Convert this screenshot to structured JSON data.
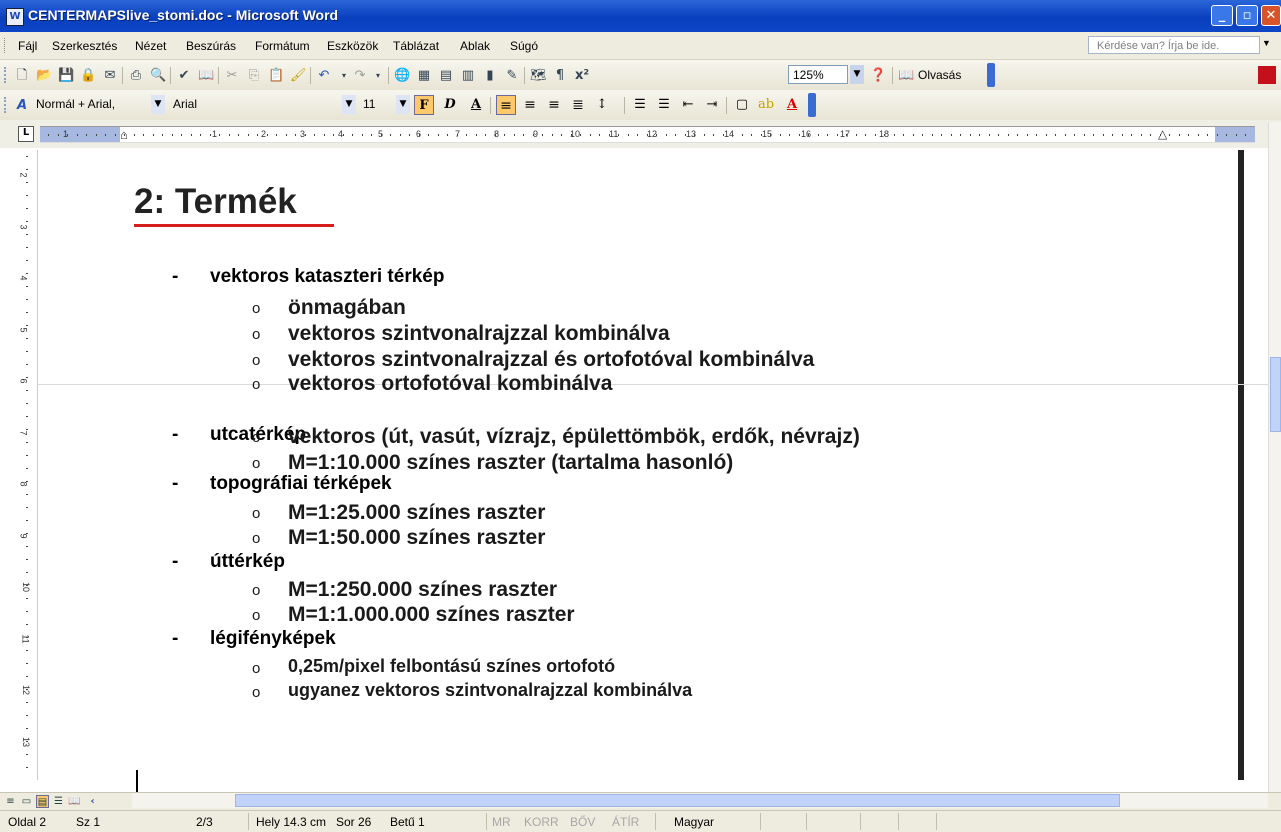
{
  "window": {
    "title": "CENTERMAPSlive_stomi.doc - Microsoft Word",
    "minimize": "_",
    "maximize": "▫",
    "close": "✕"
  },
  "menu": {
    "items": [
      "Fájl",
      "Szerkesztés",
      "Nézet",
      "Beszúrás",
      "Formátum",
      "Eszközök",
      "Táblázat",
      "Ablak",
      "Súgó"
    ],
    "ask_placeholder": "Kérdése van? Írja be ide."
  },
  "toolbar": {
    "zoom": "125%",
    "reading_label": "Olvasás"
  },
  "formatting": {
    "style": "Normál + Arial,",
    "font": "Arial",
    "size": "11",
    "bold": "F",
    "italic": "D",
    "underline": "A"
  },
  "ruler": {
    "h_numbers": [
      "1",
      "1",
      "2",
      "3",
      "4",
      "5",
      "6",
      "7",
      "8",
      "9",
      "10",
      "11",
      "12",
      "13",
      "14",
      "15",
      "16",
      "17",
      "18"
    ],
    "v_numbers": [
      "2",
      "3",
      "4",
      "5",
      "6",
      "7",
      "8",
      "9",
      "10",
      "11",
      "12",
      "13"
    ]
  },
  "document": {
    "heading": "2: Termék",
    "sections": [
      {
        "label": "vektoros kataszteri térkép",
        "items": [
          "önmagában",
          "vektoros szintvonalrajzzal kombinálva",
          "vektoros szintvonalrajzzal és ortofotóval kombinálva",
          "vektoros ortofotóval kombinálva"
        ]
      },
      {
        "label": "utcatérkép",
        "items": [
          "vektoros (út, vasút, vízrajz, épülettömbök, erdők, névrajz)",
          "M=1:10.000 színes raszter (tartalma hasonló)"
        ]
      },
      {
        "label": "topográfiai térképek",
        "items": [
          "M=1:25.000 színes raszter",
          "M=1:50.000 színes raszter"
        ]
      },
      {
        "label": "úttérkép",
        "items": [
          "M=1:250.000 színes raszter",
          "M=1:1.000.000 színes raszter"
        ]
      },
      {
        "label": "légifényképek",
        "items": [
          "0,25m/pixel felbontású színes ortofotó",
          "ugyanez vektoros szintvonalrajzzal kombinálva"
        ]
      }
    ],
    "dash": "-",
    "bullet": "o"
  },
  "status": {
    "page": "Oldal 2",
    "section": "Sz 1",
    "pages": "2/3",
    "position": "Hely 14.3 cm",
    "line": "Sor 26",
    "column": "Betű 1",
    "mr": "MR",
    "korr": "KORR",
    "bov": "BŐV",
    "atir": "ÁTÍR",
    "language": "Magyar"
  }
}
